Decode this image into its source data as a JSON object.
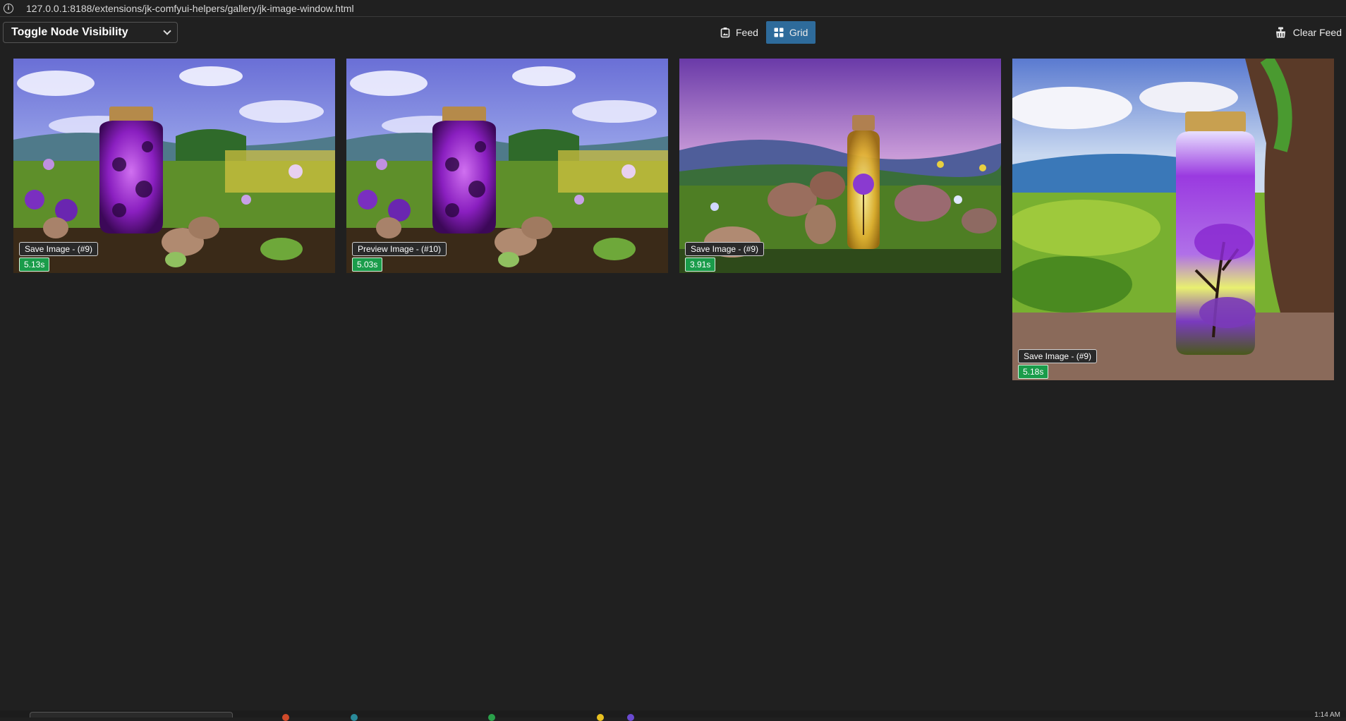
{
  "browser": {
    "url": "127.0.0.1:8188/extensions/jk-comfyui-helpers/gallery/jk-image-window.html"
  },
  "toolbar": {
    "dropdown_label": "Toggle Node Visibility",
    "feed_label": "Feed",
    "grid_label": "Grid",
    "active_view": "Grid",
    "clear_label": "Clear Feed"
  },
  "images": [
    {
      "node": "Save Image - (#9)",
      "time": "5.13s",
      "scene": "purple-jar-field"
    },
    {
      "node": "Preview Image - (#10)",
      "time": "5.03s",
      "scene": "purple-jar-field"
    },
    {
      "node": "Save Image - (#9)",
      "time": "3.91s",
      "scene": "glowing-bottle-potatoes"
    },
    {
      "node": "Save Image - (#9)",
      "time": "5.18s",
      "scene": "tree-bottle-landscape"
    }
  ],
  "taskbar": {
    "time": "1:14 AM"
  },
  "colors": {
    "background": "#202020",
    "accent_active": "#2e6b9b",
    "time_badge": "#1a9c4a"
  }
}
